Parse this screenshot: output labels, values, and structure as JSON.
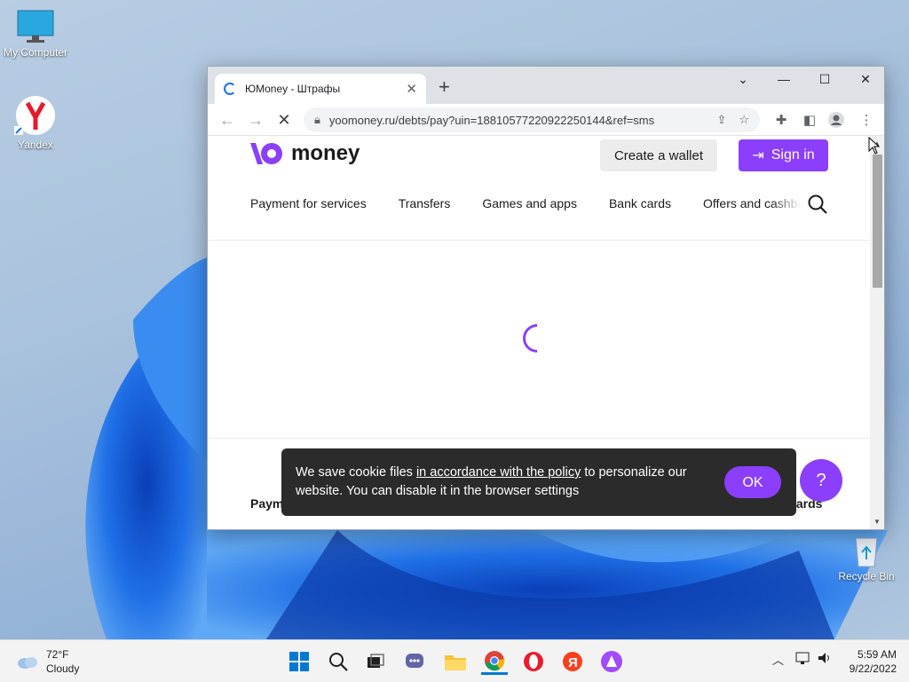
{
  "desktop": {
    "icons": [
      {
        "label": "My Computer",
        "icon": "monitor-icon"
      },
      {
        "label": "Yandex",
        "icon": "yandex-browser-icon"
      },
      {
        "label": "Recycle Bin",
        "icon": "recycle-bin-icon"
      }
    ]
  },
  "browser": {
    "tab": {
      "title": "ЮMoney - Штрафы",
      "loading": true
    },
    "new_tab_symbol": "+",
    "window_controls": {
      "dropdown": "⌄",
      "minimize": "—",
      "maximize": "☐",
      "close": "✕"
    },
    "url": "yoomoney.ru/debts/pay?uin=18810577220922250144&ref=sms"
  },
  "page": {
    "logo_text": "money",
    "create_wallet": "Create a wallet",
    "sign_in": "Sign in",
    "nav": [
      "Payment for services",
      "Transfers",
      "Games and apps",
      "Bank cards",
      "Offers and cashbacks"
    ],
    "footer_left": "Paym",
    "footer_right": "wards",
    "help_symbol": "?"
  },
  "cookie_banner": {
    "text_before": "We save cookie files ",
    "link": "in accordance with the policy",
    "text_after": " to personalize our website. You can disable it in the browser settings",
    "ok": "OK"
  },
  "taskbar": {
    "weather_temp": "72°F",
    "weather_desc": "Cloudy",
    "time": "5:59 AM",
    "date": "9/22/2022"
  },
  "colors": {
    "accent": "#8b3ffd",
    "banner_bg": "#2b2b2b"
  }
}
